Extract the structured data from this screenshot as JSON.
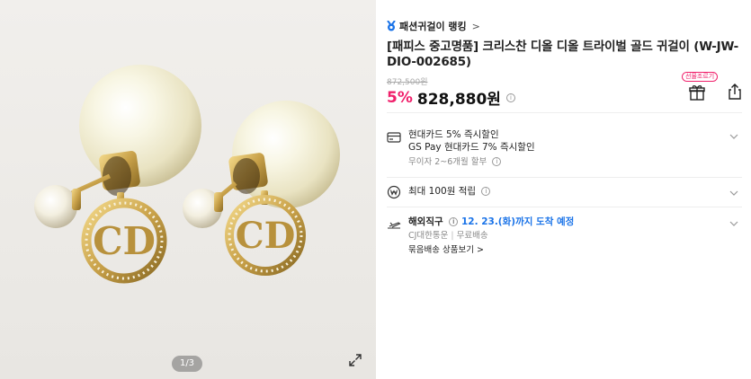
{
  "gallery": {
    "page_indicator": "1/3",
    "expand_icon": "expand-icon"
  },
  "ranking": {
    "icon": "medal-icon",
    "label": "패션귀걸이 랭킹",
    "chevron": ">"
  },
  "product": {
    "title": "[패피스 중고명품] 크리스찬 디올 디올 트라이벌 골드 귀걸이 (W-JW-DIO-002685)",
    "original_price": "872,500원",
    "discount": "5%",
    "price": "828,880원",
    "price_info_icon": "i"
  },
  "actions": {
    "gift_badge": "선물조르기",
    "gift_icon": "gift-icon",
    "share_icon": "share-icon"
  },
  "card_section": {
    "line1": "현대카드 5% 즉시할인",
    "line2": "GS Pay 현대카드 7% 즉시할인",
    "line3": "무이자 2~6개월 할부",
    "info": "ⓘ"
  },
  "points_section": {
    "label": "최대 100원 적립",
    "info": "ⓘ"
  },
  "shipping_section": {
    "label": "해외직구",
    "arrival": "12. 23.(화)까지 도착 예정",
    "carrier": "CJ대한통운",
    "fee": "무료배송",
    "bundle": "묶음배송 상품보기 >"
  },
  "colors": {
    "accent_pink": "#f0206b",
    "accent_blue": "#1a73e8",
    "gold": "#c9a24a",
    "pearl": "#f6f2d8"
  }
}
